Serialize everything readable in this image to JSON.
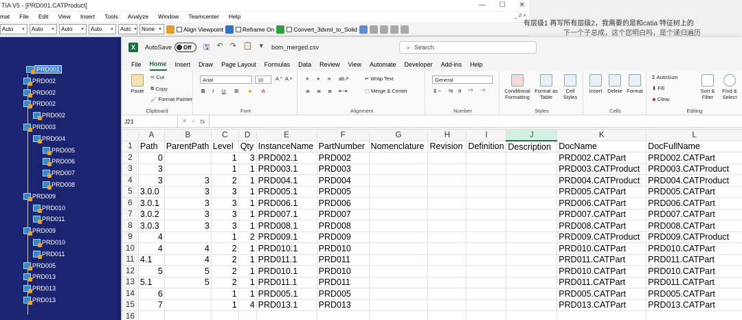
{
  "catia": {
    "title": "TIA V5 - [PRD001.CATProduct]",
    "menu": [
      "File",
      "Edit",
      "View",
      "Insert",
      "Tools",
      "Analyze",
      "Window",
      "Teamcenter",
      "Help"
    ],
    "menu_left_stub": "mat",
    "mdi_controls": "_ ∂ ×",
    "toolbar": {
      "combos": [
        "Auto",
        "Auto",
        "Auto",
        "Auto",
        "Autc",
        "None"
      ],
      "checkboxes": [
        "Align Viewpoint",
        "Reframe On",
        "Convert_3dxml_to_Solid"
      ]
    },
    "right_text_line1": "有层级1 再写所有层级2，我需要的是和catia 特征树上的",
    "right_text_line2": "下一个子总成，这个您明白吗，是个递归遍历",
    "tree": [
      {
        "label": "PRD001",
        "selected": true
      },
      {
        "label": "PRD002"
      },
      {
        "label": "PRD002"
      },
      {
        "label": "PRD002"
      },
      {
        "label": "PRD002"
      },
      {
        "label": "PRD003"
      },
      {
        "label": "PRD004"
      },
      {
        "label": "PRD005"
      },
      {
        "label": "PRD006"
      },
      {
        "label": "PRD007"
      },
      {
        "label": "PRD008"
      },
      {
        "label": "PRD009"
      },
      {
        "label": "PRD010"
      },
      {
        "label": "PRD011"
      },
      {
        "label": "PRD009"
      },
      {
        "label": "PRD010"
      },
      {
        "label": "PRD011"
      },
      {
        "label": "PRD005"
      },
      {
        "label": "PRD013"
      },
      {
        "label": "PRD013"
      },
      {
        "label": "PRD013"
      }
    ],
    "colors": {
      "tree_bg": "#1a2470",
      "selection": "#3a80d8"
    }
  },
  "excel": {
    "autosave_label": "AutoSave",
    "autosave_state": "Off",
    "filename": "bom_merged.csv",
    "search_placeholder": "Search",
    "tabs": [
      "File",
      "Home",
      "Insert",
      "Draw",
      "Page Layout",
      "Formulas",
      "Data",
      "Review",
      "View",
      "Automate",
      "Developer",
      "Add-ins",
      "Help"
    ],
    "active_tab": "Home",
    "ribbon": {
      "clipboard": {
        "paste": "Paste",
        "cut": "Cut",
        "copy": "Copy",
        "format_painter": "Format Painter",
        "label": "Clipboard"
      },
      "font": {
        "name": "Arial",
        "size": "10",
        "label": "Font"
      },
      "alignment": {
        "wrap": "Wrap Text",
        "merge": "Merge & Center",
        "label": "Alignment"
      },
      "number": {
        "format": "General",
        "label": "Number"
      },
      "styles": {
        "conditional": "Conditional Formatting",
        "format_table": "Format as Table",
        "cell_styles": "Cell Styles",
        "label": "Styles"
      },
      "cells": {
        "insert": "Insert",
        "delete": "Delete",
        "format": "Format",
        "label": "Cells"
      },
      "editing": {
        "autosum": "AutoSum",
        "fill": "Fill",
        "clear": "Clear",
        "sort": "Sort & Filter",
        "find": "Find & Select",
        "label": "Editing"
      }
    },
    "name_box": "J21",
    "fx": "fx",
    "col_letters": [
      "A",
      "B",
      "C",
      "D",
      "E",
      "F",
      "G",
      "H",
      "I",
      "J",
      "K",
      "L"
    ],
    "selected_col": "J",
    "rows": [
      [
        "Path",
        "ParentPath",
        "Level",
        "Qty",
        "InstanceName",
        "PartNumber",
        "Nomenclature",
        "Revision",
        "Definition",
        "Description",
        "DocName",
        "DocFullName"
      ],
      [
        "0",
        "",
        "1",
        "3",
        "PRD002.1",
        "PRD002",
        "",
        "",
        "",
        "",
        "PRD002.CATPart",
        "PRD002.CATPart"
      ],
      [
        "3",
        "",
        "1",
        "1",
        "PRD003.1",
        "PRD003",
        "",
        "",
        "",
        "",
        "PRD003.CATProduct",
        "PRD003.CATProduct"
      ],
      [
        "3",
        "3",
        "2",
        "1",
        "PRD004.1",
        "PRD004",
        "",
        "",
        "",
        "",
        "PRD004.CATProduct",
        "PRD004.CATProduct"
      ],
      [
        "3.0.0",
        "3",
        "3",
        "1",
        "PRD005.1",
        "PRD005",
        "",
        "",
        "",
        "",
        "PRD005.CATPart",
        "PRD005.CATPart"
      ],
      [
        "3.0.1",
        "3",
        "3",
        "1",
        "PRD006.1",
        "PRD006",
        "",
        "",
        "",
        "",
        "PRD006.CATPart",
        "PRD006.CATPart"
      ],
      [
        "3.0.2",
        "3",
        "3",
        "1",
        "PRD007.1",
        "PRD007",
        "",
        "",
        "",
        "",
        "PRD007.CATPart",
        "PRD007.CATPart"
      ],
      [
        "3.0.3",
        "3",
        "3",
        "1",
        "PRD008.1",
        "PRD008",
        "",
        "",
        "",
        "",
        "PRD008.CATPart",
        "PRD008.CATPart"
      ],
      [
        "4",
        "",
        "1",
        "2",
        "PRD009.1",
        "PRD009",
        "",
        "",
        "",
        "",
        "PRD009.CATProduct",
        "PRD009.CATProduct"
      ],
      [
        "4",
        "4",
        "2",
        "1",
        "PRD010.1",
        "PRD010",
        "",
        "",
        "",
        "",
        "PRD010.CATPart",
        "PRD010.CATPart"
      ],
      [
        "4.1",
        "4",
        "2",
        "1",
        "PRD011.1",
        "PRD011",
        "",
        "",
        "",
        "",
        "PRD011.CATPart",
        "PRD011.CATPart"
      ],
      [
        "5",
        "5",
        "2",
        "1",
        "PRD010.1",
        "PRD010",
        "",
        "",
        "",
        "",
        "PRD010.CATPart",
        "PRD010.CATPart"
      ],
      [
        "5.1",
        "5",
        "2",
        "1",
        "PRD011.1",
        "PRD011",
        "",
        "",
        "",
        "",
        "PRD011.CATPart",
        "PRD011.CATPart"
      ],
      [
        "6",
        "",
        "1",
        "1",
        "PRD005.1",
        "PRD005",
        "",
        "",
        "",
        "",
        "PRD005.CATPart",
        "PRD005.CATPart"
      ],
      [
        "7",
        "",
        "1",
        "4",
        "PRD013.1",
        "PRD013",
        "",
        "",
        "",
        "",
        "PRD013.CATPart",
        "PRD013.CATPart"
      ]
    ],
    "numeric_cols": [
      0,
      1,
      2,
      3
    ],
    "next_row_number": "16",
    "colors": {
      "accent": "#1d6f42",
      "selected_header_bg": "#d3f0e0"
    }
  }
}
